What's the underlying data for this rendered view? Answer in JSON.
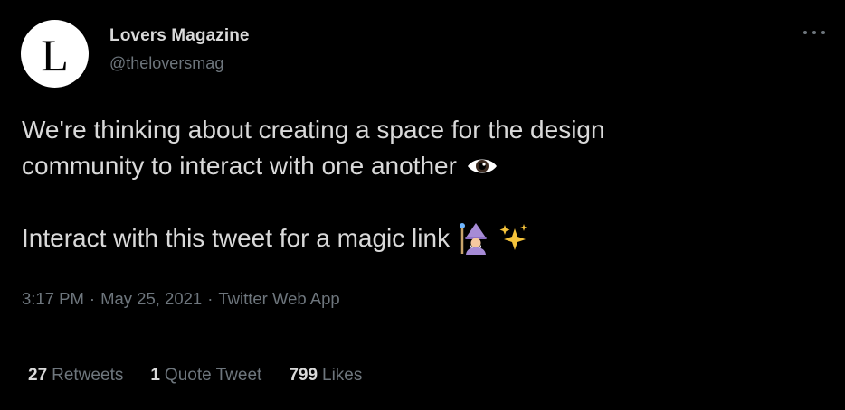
{
  "author": {
    "avatar_letter": "L",
    "display_name": "Lovers Magazine",
    "handle": "@theloversmag"
  },
  "tweet": {
    "line1": "We're thinking about creating a space for the design",
    "line2": "community to interact with one another",
    "line2_emoji": "eye-emoji",
    "line3": "Interact with this tweet for a magic link",
    "line3_emojis": [
      "mage-emoji",
      "sparkles-emoji"
    ]
  },
  "meta": {
    "time": "3:17 PM",
    "date": "May 25, 2021",
    "source": "Twitter Web App",
    "separator": "·"
  },
  "stats": {
    "retweets_count": "27",
    "retweets_label": "Retweets",
    "quotes_count": "1",
    "quotes_label": "Quote Tweet",
    "likes_count": "799",
    "likes_label": "Likes"
  },
  "colors": {
    "background": "#000000",
    "primary_text": "#d9d9d9",
    "secondary_text": "#6e767d",
    "divider": "#2f3336"
  }
}
